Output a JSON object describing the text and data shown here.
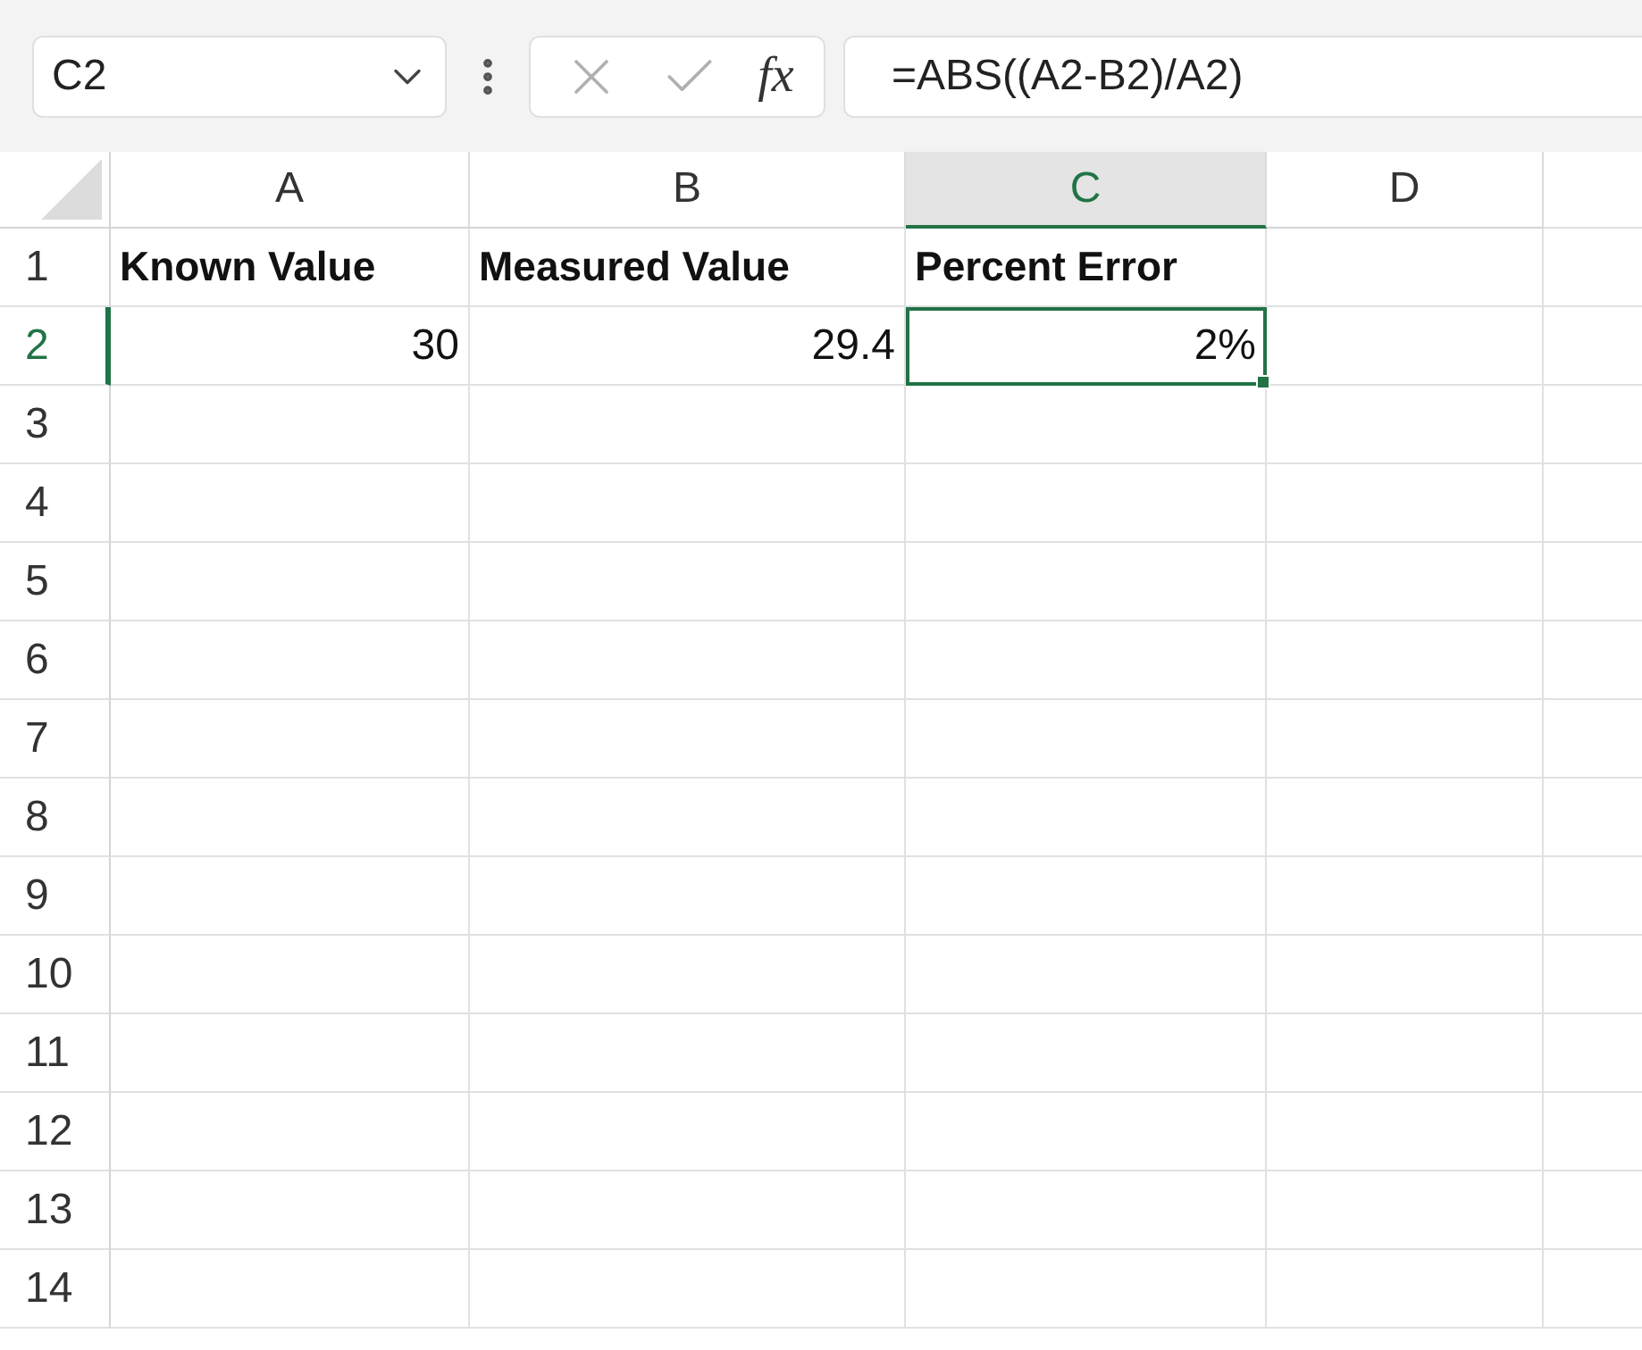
{
  "name_box": {
    "value": "C2"
  },
  "formula_bar": {
    "function_label": "fx",
    "value": "=ABS((A2-B2)/A2)"
  },
  "columns": [
    {
      "label": "A",
      "selected": false
    },
    {
      "label": "B",
      "selected": false
    },
    {
      "label": "C",
      "selected": true
    },
    {
      "label": "D",
      "selected": false
    }
  ],
  "rows": [
    {
      "label": "1",
      "selected": false,
      "cells": [
        {
          "value": "Known Value",
          "kind": "header",
          "selected": false
        },
        {
          "value": "Measured Value",
          "kind": "header",
          "selected": false
        },
        {
          "value": "Percent Error",
          "kind": "header",
          "selected": false
        }
      ]
    },
    {
      "label": "2",
      "selected": true,
      "cells": [
        {
          "value": "30",
          "kind": "number",
          "selected": false
        },
        {
          "value": "29.4",
          "kind": "number",
          "selected": false
        },
        {
          "value": "2%",
          "kind": "number",
          "selected": true
        }
      ]
    },
    {
      "label": "3",
      "selected": false
    },
    {
      "label": "4",
      "selected": false
    },
    {
      "label": "5",
      "selected": false
    },
    {
      "label": "6",
      "selected": false
    },
    {
      "label": "7",
      "selected": false
    },
    {
      "label": "8",
      "selected": false
    },
    {
      "label": "9",
      "selected": false
    },
    {
      "label": "10",
      "selected": false
    },
    {
      "label": "11",
      "selected": false
    },
    {
      "label": "12",
      "selected": false
    },
    {
      "label": "13",
      "selected": false
    },
    {
      "label": "14",
      "selected": false
    }
  ]
}
